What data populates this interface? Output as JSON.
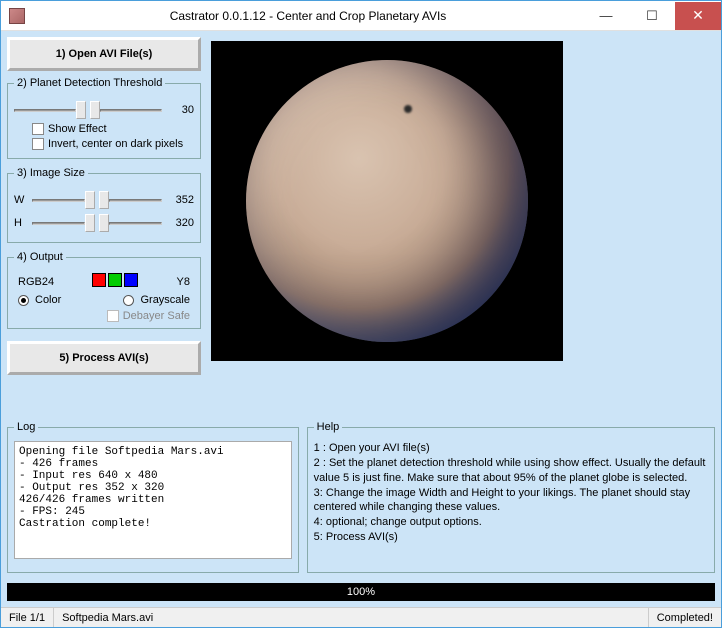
{
  "window": {
    "title": "Castrator 0.0.1.12 - Center and Crop Planetary AVIs"
  },
  "buttons": {
    "open": "1) Open AVI File(s)",
    "process": "5) Process AVI(s)"
  },
  "threshold": {
    "legend": "2) Planet Detection Threshold",
    "value": "30",
    "show_effect": "Show Effect",
    "invert": "Invert, center on dark pixels"
  },
  "imagesize": {
    "legend": "3) Image Size",
    "w_label": "W",
    "w_value": "352",
    "h_label": "H",
    "h_value": "320"
  },
  "output": {
    "legend": "4) Output",
    "rgb_label": "RGB24",
    "y8_label": "Y8",
    "color_label": "Color",
    "grayscale_label": "Grayscale",
    "debayer_label": "Debayer Safe"
  },
  "log": {
    "legend": "Log",
    "text": "Opening file Softpedia Mars.avi\n - 426 frames\n - Input res 640 x 480\n - Output res 352 x 320\n426/426 frames written\n - FPS: 245\nCastration complete!"
  },
  "help": {
    "legend": "Help",
    "line1": "1 : Open your AVI file(s)",
    "line2": "2 : Set the planet detection threshold while using show effect. Usually the default value 5 is just fine. Make sure that about 95% of the planet globe is selected.",
    "line3": "3: Change the image Width and Height to your likings. The planet should stay centered while changing these values.",
    "line4": "4: optional; change output options.",
    "line5": "5: Process AVI(s)"
  },
  "progress": {
    "text": "100%"
  },
  "status": {
    "file_count": "File 1/1",
    "filename": "Softpedia Mars.avi",
    "state": "Completed!"
  }
}
